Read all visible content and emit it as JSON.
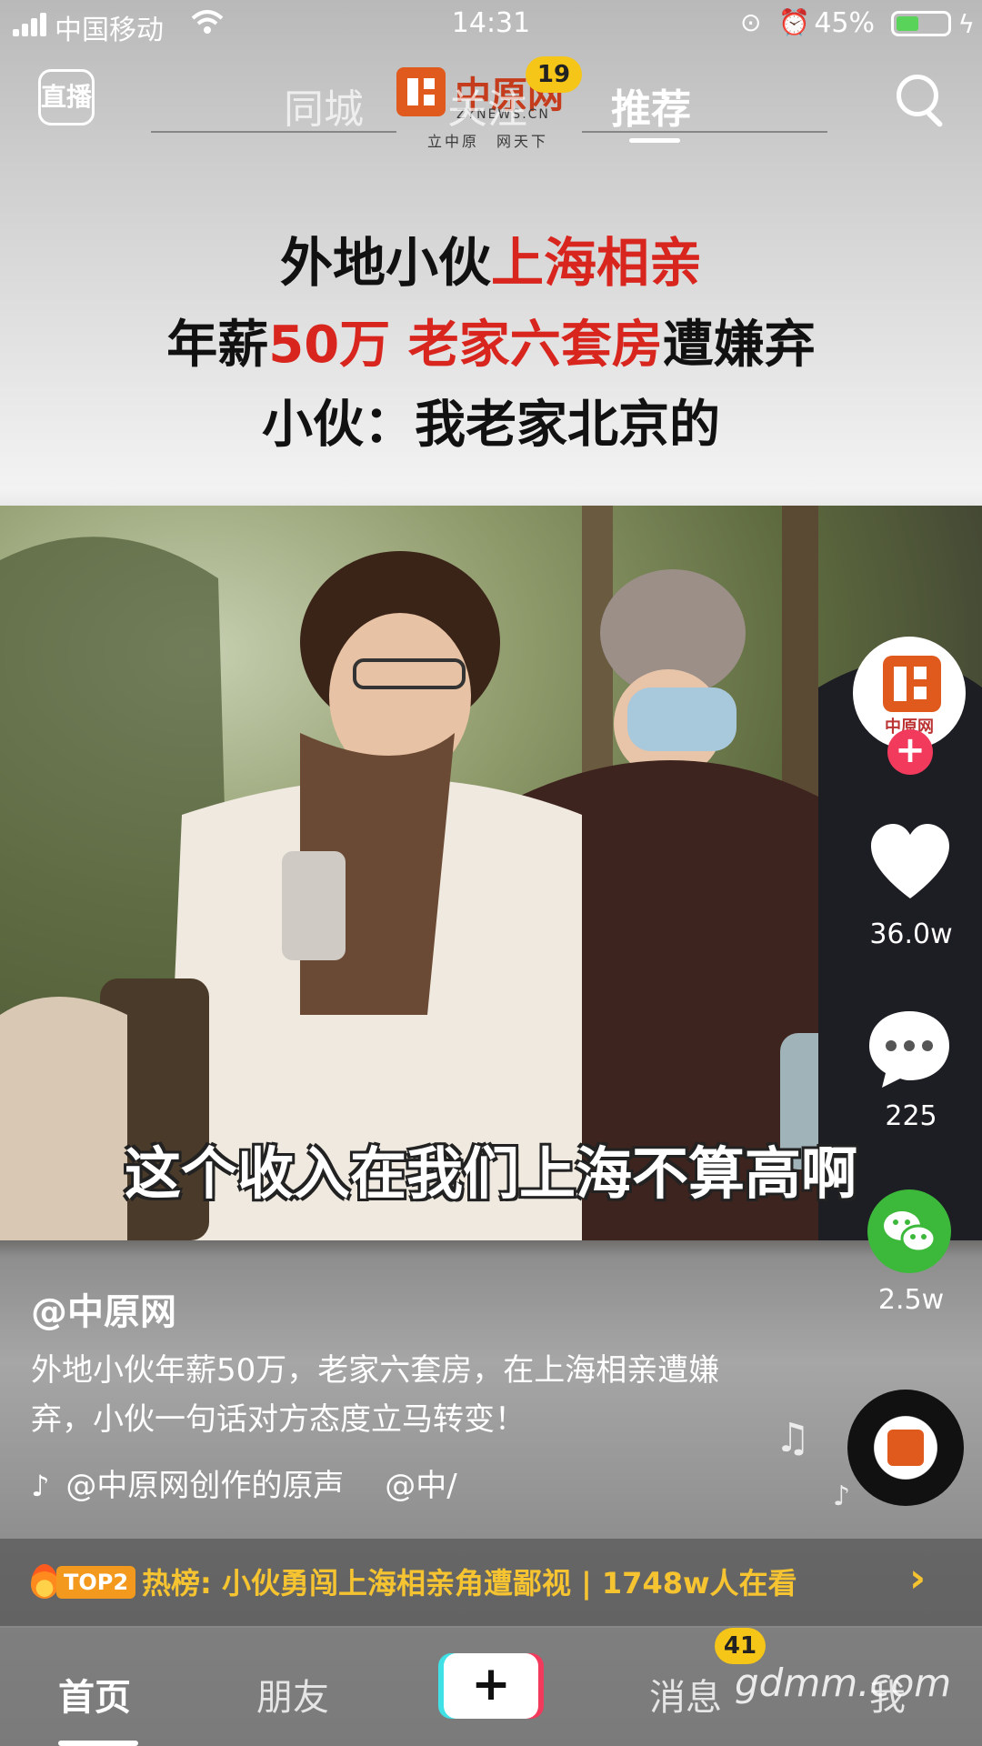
{
  "status_bar": {
    "carrier": "中国移动",
    "time": "14:31",
    "battery_percent": "45%",
    "battery_level": 0.45,
    "icons": [
      "signal-icon",
      "wifi-icon",
      "rotation-lock-icon",
      "alarm-icon",
      "battery-icon",
      "charging-icon"
    ]
  },
  "top_nav": {
    "live_label": "直播",
    "tabs": [
      {
        "label": "同城"
      },
      {
        "label": "关注",
        "badge": "19"
      },
      {
        "label": "推荐",
        "active": true
      }
    ],
    "logo": {
      "cn": "中原网",
      "en": "ZYNEWS.CN",
      "slogan": "立中原　网天下"
    }
  },
  "headline": {
    "line1_a": "外地小伙",
    "line1_b": "上海相亲",
    "line2_a": "年薪",
    "line2_b": "50万 老家六套房",
    "line2_c": "遭嫌弃",
    "line3": "小伙：我老家北京的"
  },
  "video": {
    "subtitle": "这个收入在我们上海不算高啊"
  },
  "right_rail": {
    "avatar_name": "中原网",
    "likes": "36.0w",
    "comments": "225",
    "shares": "2.5w"
  },
  "caption": {
    "author": "@中原网",
    "description": "外地小伙年薪50万，老家六套房，在上海相亲遭嫌弃，小伙一句话对方态度立马转变！",
    "music": "@中原网创作的原声　 @中/"
  },
  "hot_bar": {
    "rank": "TOP2",
    "text": "热榜: 小伙勇闯上海相亲角遭鄙视 | 1748w人在看",
    "arrow": "›"
  },
  "bottom_nav": {
    "home": "首页",
    "friends": "朋友",
    "plus": "+",
    "messages": "消息",
    "messages_badge": "41",
    "me": "我",
    "watermark": "gdmm.com"
  },
  "colors": {
    "accent_red": "#d8261f",
    "hot_yellow": "#f6c431",
    "badge_yellow": "#f5c518",
    "follow_pink": "#f23a5c",
    "wechat_green": "#3cb93a",
    "logo_orange": "#e05a1e"
  }
}
